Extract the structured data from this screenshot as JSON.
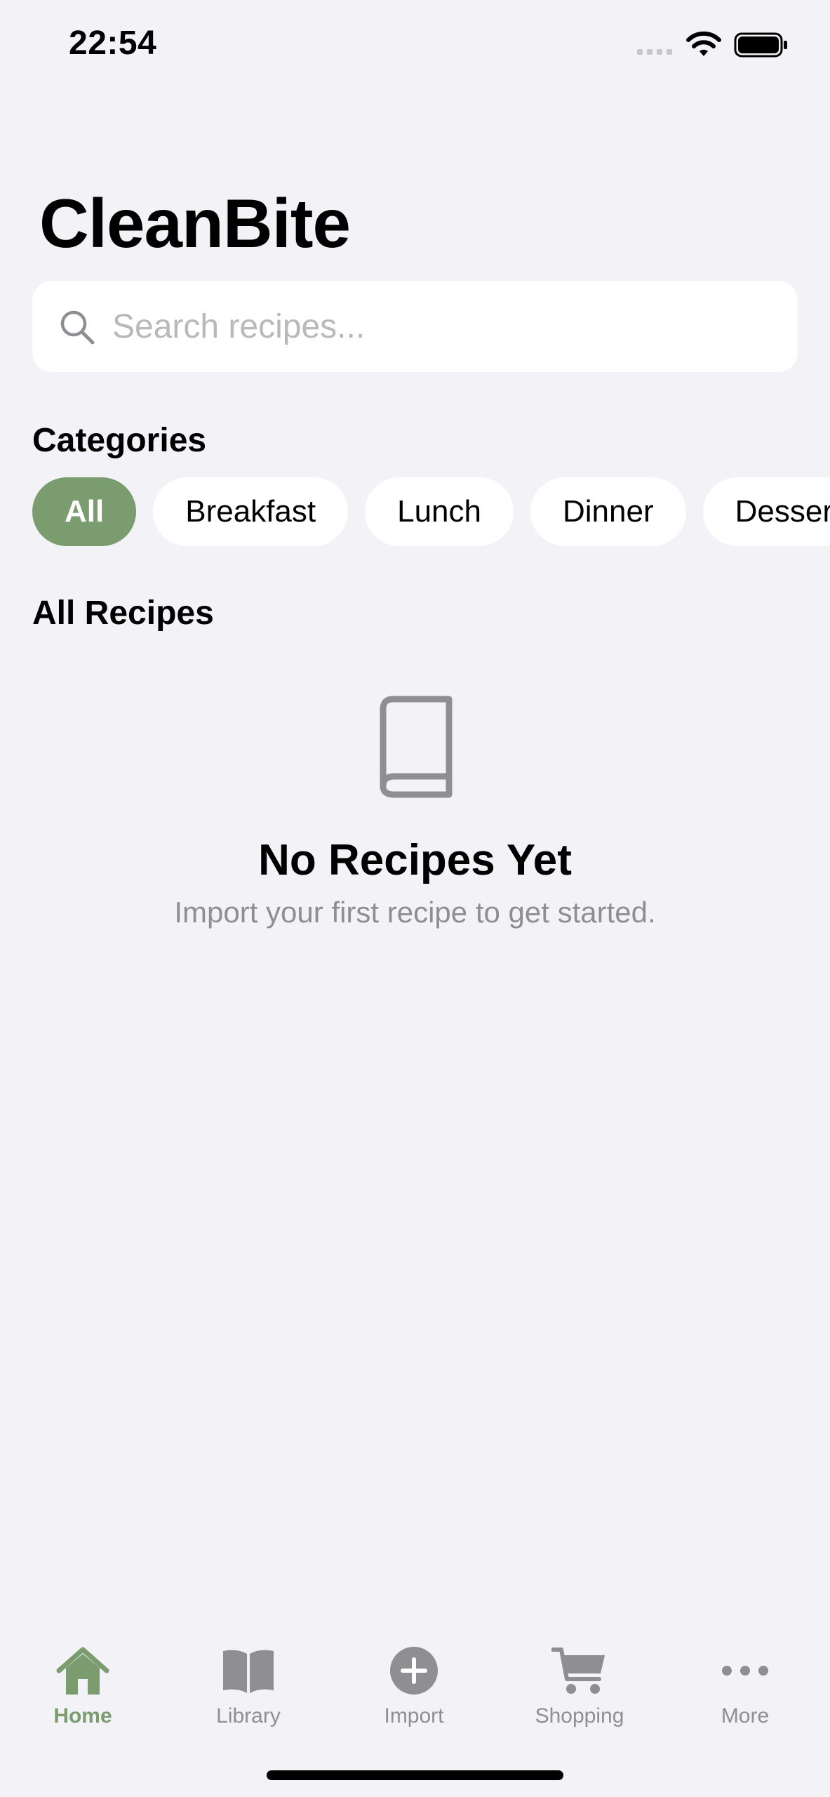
{
  "status_bar": {
    "time": "22:54"
  },
  "app": {
    "title": "CleanBite"
  },
  "search": {
    "placeholder": "Search recipes...",
    "value": ""
  },
  "categories": {
    "heading": "Categories",
    "items": [
      {
        "label": "All",
        "active": true
      },
      {
        "label": "Breakfast",
        "active": false
      },
      {
        "label": "Lunch",
        "active": false
      },
      {
        "label": "Dinner",
        "active": false
      },
      {
        "label": "Dessert",
        "active": false
      }
    ]
  },
  "recipes": {
    "heading": "All Recipes",
    "empty_icon": "book-icon",
    "empty_title": "No Recipes Yet",
    "empty_subtitle": "Import your first recipe to get started."
  },
  "tab_bar": {
    "tabs": [
      {
        "label": "Home",
        "icon": "home-icon",
        "active": true
      },
      {
        "label": "Library",
        "icon": "library-icon",
        "active": false
      },
      {
        "label": "Import",
        "icon": "plus-circle-icon",
        "active": false
      },
      {
        "label": "Shopping",
        "icon": "cart-icon",
        "active": false
      },
      {
        "label": "More",
        "icon": "more-icon",
        "active": false
      }
    ]
  },
  "colors": {
    "accent": "#7a9c6e",
    "background": "#f2f2f7",
    "secondary_text": "#8e8e93",
    "placeholder": "#b8b8bd"
  }
}
